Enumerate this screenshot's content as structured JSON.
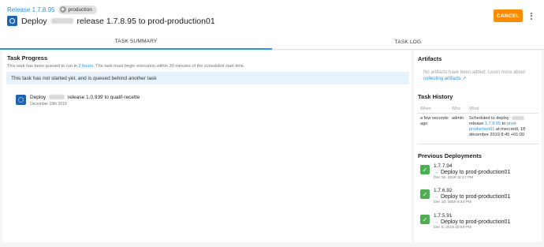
{
  "header": {
    "breadcrumb": "Release 1.7.8.95",
    "environment": "production",
    "title_prefix": "Deploy",
    "title_suffix": "release 1.7.8.95 to prod-production01",
    "cancel_label": "CANCEL"
  },
  "tabs": [
    "TASK SUMMARY",
    "TASK LOG"
  ],
  "progress": {
    "heading": "Task Progress",
    "note_a": "This task has been queued to run in",
    "note_link": "2 hours",
    "note_b": ". The task must begin execution within 30 minutes of the scheduled start time.",
    "alert": "This task has not started yet, and is queued behind another task",
    "queued_prefix": "Deploy",
    "queued_suffix": "release 1.0.939 to qualif-recette",
    "queued_date": "December 18th 2019"
  },
  "artifacts": {
    "heading": "Artifacts",
    "text": "No artifacts have been added. Learn more about",
    "link": "collecting artifacts"
  },
  "history": {
    "heading": "Task History",
    "columns": [
      "When",
      "Who",
      "What"
    ],
    "row": {
      "when": "a few seconds ago",
      "who": "admin",
      "what_a": "Scheduled to deploy",
      "what_b": "release",
      "what_release": "1.7.8.95",
      "what_to": "to",
      "what_env": "prod-production01",
      "what_at": "at mercredi, 18 décembre 2019 8:45 +01:00"
    }
  },
  "previous": {
    "heading": "Previous Deployments",
    "items": [
      {
        "version": "1.7.7.94",
        "target": "Deploy to prod-production01",
        "date": "Dec 16, 2019 11:17 PM"
      },
      {
        "version": "1.7.6.92",
        "target": "Deploy to prod-production01",
        "date": "Dec 10, 2019 9:44 PM"
      },
      {
        "version": "1.7.5.91",
        "target": "Deploy to prod-production01",
        "date": "Dec 8, 2019 10:53 PM"
      }
    ]
  },
  "colors": {
    "accent": "#2f93e0",
    "cancel": "#ff8c00",
    "success": "#4caf50",
    "deploy_icon": "#1e63b0"
  }
}
